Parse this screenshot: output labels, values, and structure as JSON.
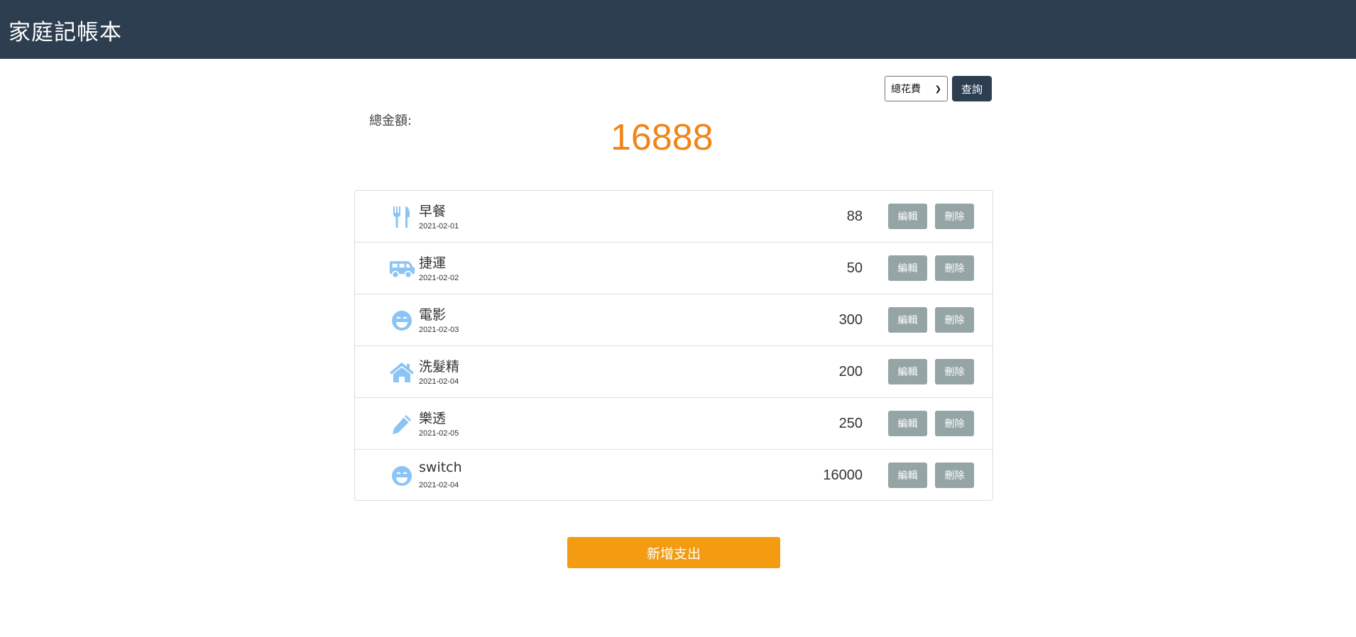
{
  "header": {
    "title": "家庭記帳本"
  },
  "filter": {
    "selected": "總花費",
    "query_label": "查詢"
  },
  "summary": {
    "label": "總金額:",
    "total": "16888"
  },
  "colors": {
    "header_bg": "#2c3e50",
    "accent_total": "#f0851a",
    "add_button": "#f39c12",
    "row_button": "#95a5a6",
    "icon_color": "#8bc4f5"
  },
  "expenses": [
    {
      "icon": "utensils-icon",
      "name": "早餐",
      "date": "2021-02-01",
      "amount": "88"
    },
    {
      "icon": "van-icon",
      "name": "捷運",
      "date": "2021-02-02",
      "amount": "50"
    },
    {
      "icon": "smile-icon",
      "name": "電影",
      "date": "2021-02-03",
      "amount": "300"
    },
    {
      "icon": "home-icon",
      "name": "洗髮精",
      "date": "2021-02-04",
      "amount": "200"
    },
    {
      "icon": "pencil-icon",
      "name": "樂透",
      "date": "2021-02-05",
      "amount": "250"
    },
    {
      "icon": "smile-icon",
      "name": "switch",
      "date": "2021-02-04",
      "amount": "16000"
    }
  ],
  "row_actions": {
    "edit_label": "編輯",
    "delete_label": "刪除"
  },
  "add_button": {
    "label": "新增支出"
  }
}
